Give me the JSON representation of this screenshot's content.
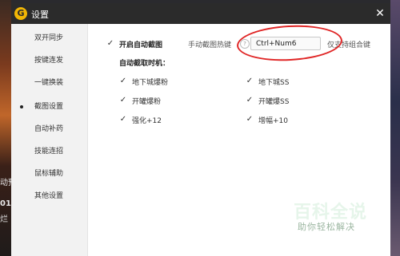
{
  "window": {
    "title": "设置",
    "close_icon": "close-icon"
  },
  "sidebar": {
    "items": [
      {
        "label": "双开同步"
      },
      {
        "label": "按键连发"
      },
      {
        "label": "一键换装"
      },
      {
        "label": "截图设置",
        "active": true
      },
      {
        "label": "自动补药"
      },
      {
        "label": "技能连招"
      },
      {
        "label": "鼠标辅助"
      },
      {
        "label": "其他设置"
      }
    ]
  },
  "screenshot": {
    "enable_label": "开启自动截图",
    "enable_checked": true,
    "hotkey_label": "手动截图热键",
    "help_icon": "?",
    "hotkey_value": "Ctrl+Num6",
    "hotkey_note": "仅支持组合键",
    "timing_title": "自动截取时机：",
    "options": [
      {
        "label": "地下城爆粉",
        "checked": true
      },
      {
        "label": "地下城SS",
        "checked": true
      },
      {
        "label": "开罐爆粉",
        "checked": true
      },
      {
        "label": "开罐爆SS",
        "checked": true
      },
      {
        "label": "强化+12",
        "checked": true
      },
      {
        "label": "增幅+10",
        "checked": true
      }
    ]
  },
  "background": {
    "left_text": [
      "动预",
      "01",
      "烂"
    ]
  },
  "watermark": {
    "main": "百科全说",
    "sub": "助你轻松解决"
  },
  "colors": {
    "titlebar": "#2b2b2b",
    "logo": "#f2b705",
    "annotation": "#e02626",
    "sidebar": "#f2f2f2"
  }
}
